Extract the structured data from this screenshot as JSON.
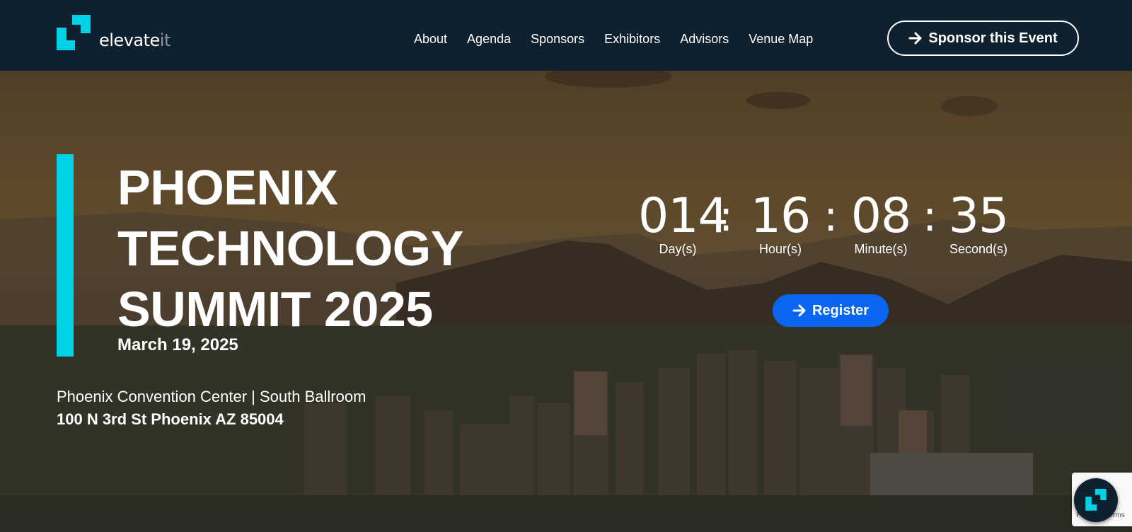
{
  "header": {
    "logo": {
      "text_main": "elevate",
      "text_accent": "it",
      "icon": "elevateit-logo-icon"
    },
    "nav": [
      {
        "label": "About"
      },
      {
        "label": "Agenda"
      },
      {
        "label": "Sponsors"
      },
      {
        "label": "Exhibitors"
      },
      {
        "label": "Advisors"
      },
      {
        "label": "Venue Map"
      }
    ],
    "sponsor_button": {
      "label": "Sponsor this Event",
      "icon": "arrow-right-icon"
    }
  },
  "hero": {
    "title_lines": [
      "PHOENIX",
      "TECHNOLOGY",
      "SUMMIT 2025"
    ],
    "date": "March 19, 2025",
    "venue": "Phoenix Convention Center | South Ballroom",
    "address": "100 N 3rd St Phoenix AZ 85004",
    "accent_color": "#00d2e6"
  },
  "countdown": {
    "days": {
      "value": "014",
      "label": "Day(s)"
    },
    "hours": {
      "value": "16",
      "label": "Hour(s)"
    },
    "minutes": {
      "value": "08",
      "label": "Minute(s)"
    },
    "seconds": {
      "value": "35",
      "label": "Second(s)"
    },
    "separator": ":"
  },
  "register_button": {
    "label": "Register",
    "icon": "arrow-right-icon",
    "color": "#0a66f0"
  },
  "recaptcha": {
    "text": "Privacy - Terms"
  },
  "chat_widget": {
    "icon": "elevateit-chat-icon"
  }
}
